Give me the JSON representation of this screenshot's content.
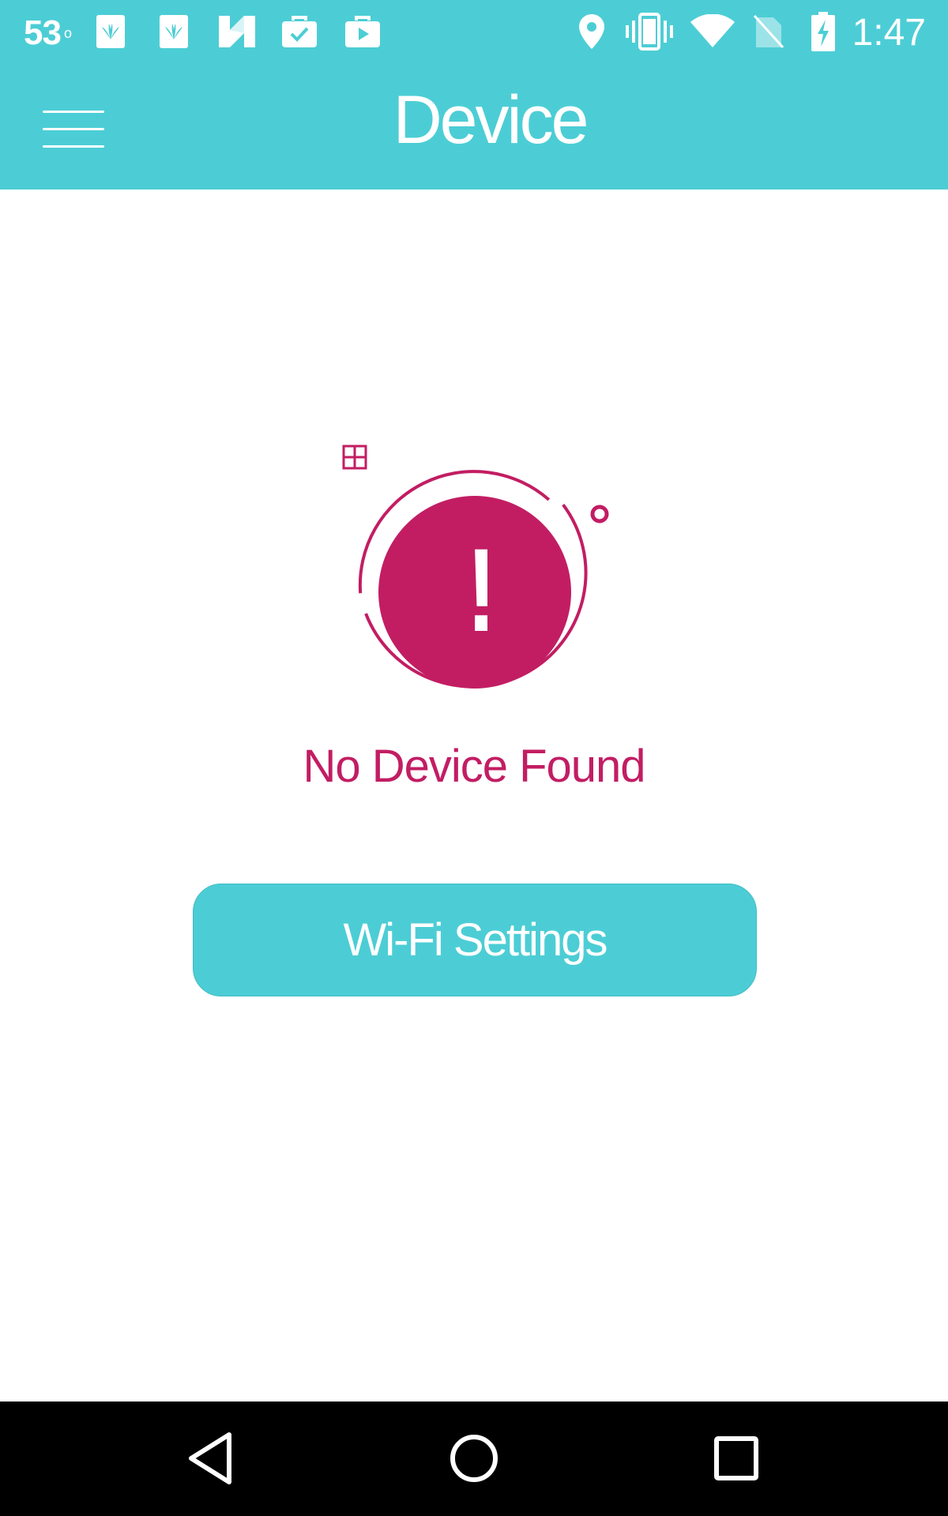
{
  "status_bar": {
    "temperature": "53",
    "degree_symbol": "o",
    "time": "1:47",
    "icons": [
      "huawei-logo-icon",
      "huawei-logo-icon",
      "n-logo-icon",
      "briefcase-check-icon",
      "briefcase-play-icon",
      "location-pin-icon",
      "vibrate-icon",
      "wifi-icon",
      "no-sim-icon",
      "battery-charging-icon"
    ]
  },
  "app_bar": {
    "title": "Device",
    "menu_icon": "hamburger-menu-icon"
  },
  "main": {
    "status_icon": "exclamation-alert-icon",
    "exclamation_mark": "!",
    "message": "No Device Found",
    "wifi_button_label": "Wi-Fi Settings"
  },
  "nav_bar": {
    "buttons": [
      "back-icon",
      "home-icon",
      "recent-apps-icon"
    ]
  },
  "colors": {
    "teal": "#4ccdd5",
    "magenta": "#c21d63",
    "white": "#ffffff",
    "black": "#000000"
  }
}
